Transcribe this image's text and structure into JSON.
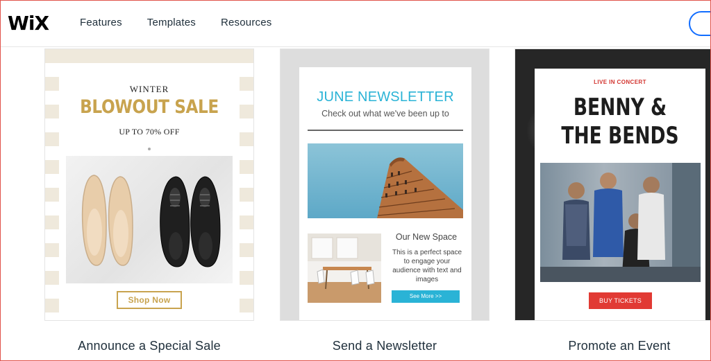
{
  "header": {
    "logo": "WiX",
    "nav": [
      "Features",
      "Templates",
      "Resources"
    ]
  },
  "cards": [
    {
      "label": "Announce a Special Sale",
      "winter": "WINTER",
      "title": "BLOWOUT SALE",
      "subtitle": "UP TO 70% OFF",
      "button": "Shop Now"
    },
    {
      "label": "Send a Newsletter",
      "title": "JUNE NEWSLETTER",
      "subtitle": "Check out what we've been up to",
      "section_title": "Our New Space",
      "section_body": "This is a perfect space to engage your audience with text and images",
      "button": "See More >>"
    },
    {
      "label": "Promote an Event",
      "kicker": "LIVE IN CONCERT",
      "title_line1": "BENNY &",
      "title_line2": "THE BENDS",
      "button": "BUY TICKETS"
    }
  ],
  "colors": {
    "brand_gold": "#c8a34e",
    "newsletter_blue": "#2ab3d6",
    "event_red": "#e13a34",
    "cta_blue": "#116dff"
  }
}
